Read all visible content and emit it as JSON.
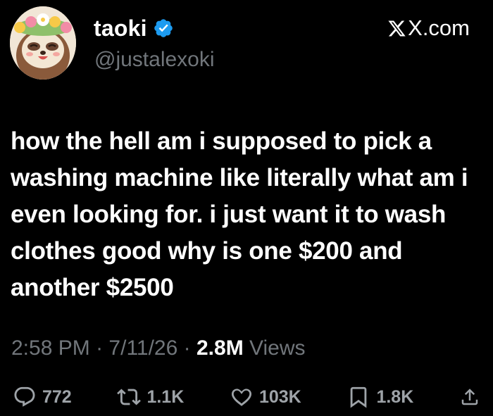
{
  "author": {
    "display_name": "taoki",
    "handle": "@justalexoki",
    "verified": true,
    "avatar": "sloth-with-flower-crown-avatar"
  },
  "brand": {
    "label": "X.com",
    "icon": "x-logo-icon"
  },
  "tweet": {
    "text": "how the hell am i supposed to pick a washing machine like literally what am i even looking for. i just want it to wash clothes good why is one $200 and another $2500"
  },
  "meta": {
    "time": "2:58 PM",
    "separator": "·",
    "date": "7/11/26",
    "views_count": "2.8M",
    "views_label": "Views"
  },
  "actions": {
    "replies": "772",
    "reposts": "1.1K",
    "likes": "103K",
    "bookmarks": "1.8K"
  },
  "colors": {
    "background": "#000000",
    "text": "#ffffff",
    "muted": "#71767b",
    "verified": "#1d9bf0"
  }
}
